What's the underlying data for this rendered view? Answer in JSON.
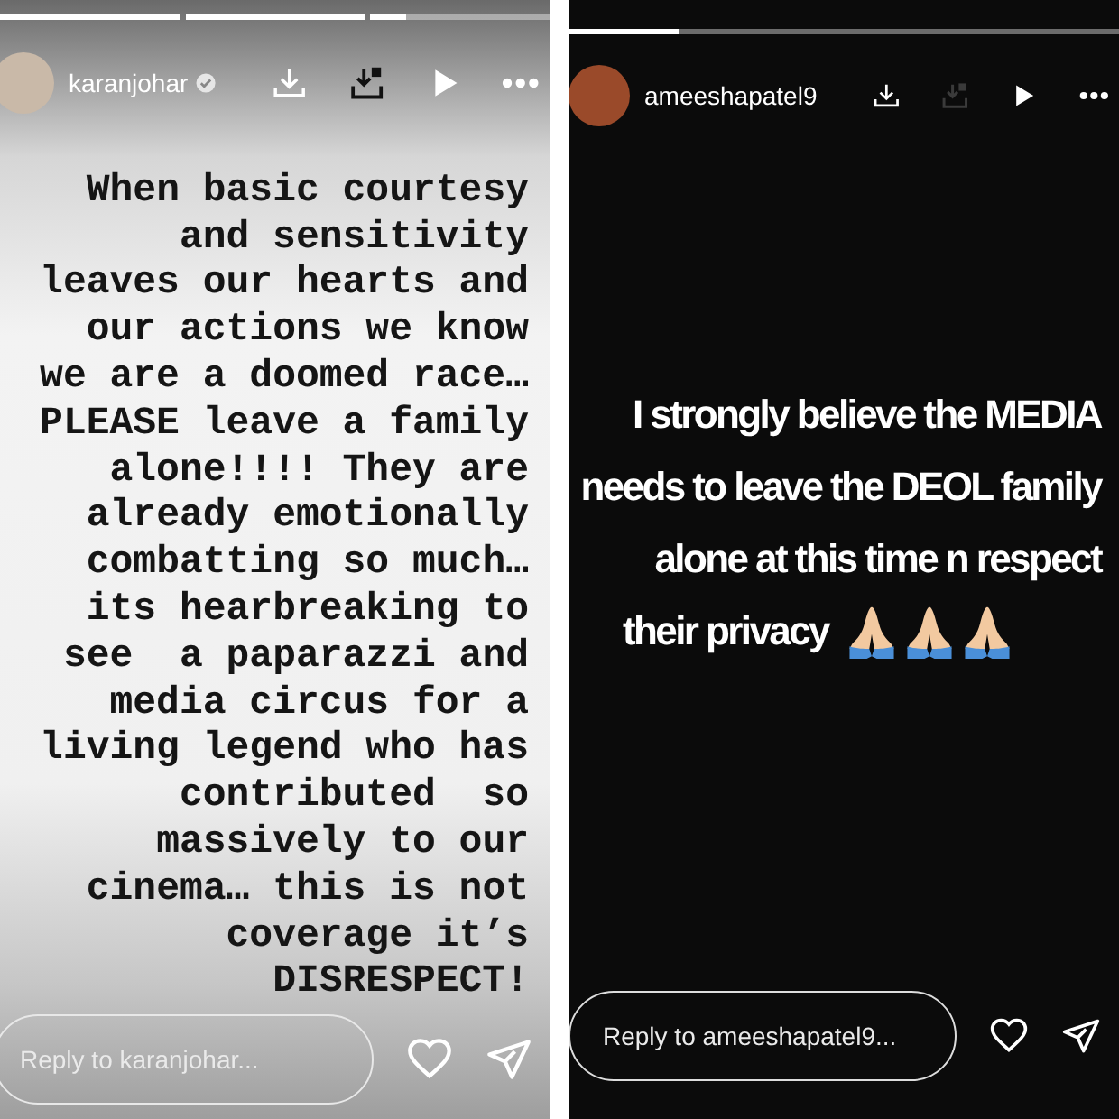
{
  "stories": [
    {
      "kind": "typewriter",
      "progress": [
        {
          "level": 1
        },
        {
          "level": 1
        },
        {
          "level": 0.2
        }
      ],
      "username": "karanjohar",
      "verified": true,
      "save_enabled": true,
      "text": "When basic courtesy\nand sensitivity\nleaves our hearts and\nour actions we know\nwe are a doomed race…\nPLEASE leave a family\nalone!!!! They are\nalready emotionally\ncombatting so much…\nits hearbreaking to\nsee  a paparazzi and\nmedia circus for a\nliving legend who has\ncontributed  so\nmassively to our\ncinema… this is not\ncoverage it’s\nDISRESPECT!",
      "reply": {
        "placeholder": "Reply to karanjohar..."
      }
    },
    {
      "kind": "caption",
      "progress": [
        {
          "level": 0.2
        }
      ],
      "username": "ameeshapatel9",
      "verified": false,
      "save_enabled": false,
      "text": "I strongly believe the MEDIA\nneeds to leave the DEOL family\nalone at this time n respect\ntheir privacy",
      "reply": {
        "placeholder": "Reply to ameeshapatel9..."
      }
    }
  ]
}
